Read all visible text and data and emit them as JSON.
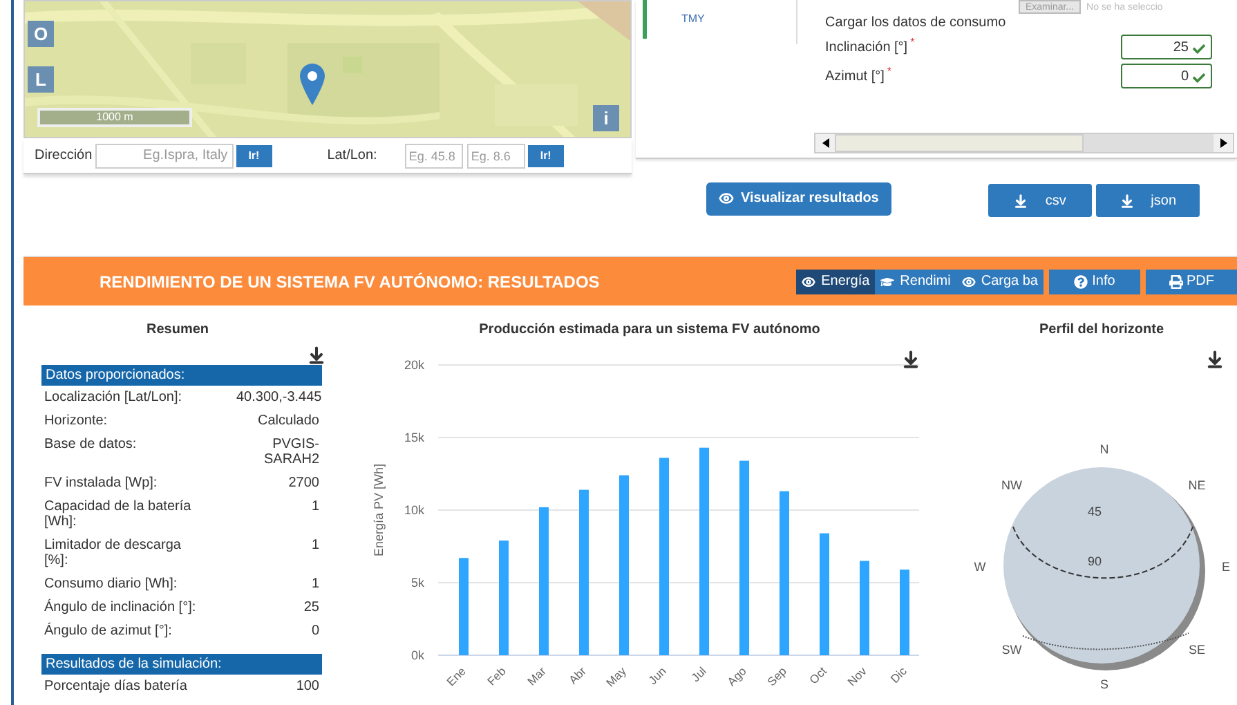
{
  "map": {
    "layer_buttons": [
      "O",
      "L"
    ],
    "info_button": "i",
    "scale": "1000 m"
  },
  "search": {
    "address_label": "Dirección",
    "address_placeholder": "Eg.Ispra, Italy",
    "address_go": "Ir!",
    "latlon_label": "Lat/Lon:",
    "lat_placeholder": "Eg. 45.8",
    "lon_placeholder": "Eg. 8.6",
    "latlon_go": "Ir!"
  },
  "side_tabs": [
    {
      "label": "TMY",
      "selected": true
    }
  ],
  "form": {
    "file_button": "Examinar...",
    "file_status": "No se ha seleccio",
    "consumption_label": "Cargar los datos de consumo",
    "fields": [
      {
        "label": "Inclinación [°]",
        "required_mark": "*",
        "value": "25",
        "valid": true
      },
      {
        "label": "Azimut [°]",
        "required_mark": "*",
        "value": "0",
        "valid": true
      }
    ]
  },
  "actions": {
    "visualize": "Visualizar resultados",
    "downloads": [
      "csv",
      "json"
    ]
  },
  "results": {
    "title": "RENDIMIENTO DE UN SISTEMA FV AUTÓNOMO: RESULTADOS",
    "tabs": [
      {
        "label": "Energía",
        "selected": true
      },
      {
        "label": "Rendimi",
        "selected": false
      },
      {
        "label": "Carga ba",
        "selected": false
      }
    ],
    "buttons": [
      {
        "kind": "info",
        "label": "Info"
      },
      {
        "kind": "pdf",
        "label": "PDF"
      }
    ]
  },
  "summary": {
    "title": "Resumen",
    "sections": [
      {
        "heading": "Datos proporcionados:",
        "rows": [
          {
            "label": "Localización [Lat/Lon]:",
            "value": "40.300,-3.445"
          },
          {
            "label": "Horizonte:",
            "value": "Calculado"
          },
          {
            "label": "Base de datos:",
            "value": "PVGIS-SARAH2"
          },
          {
            "label": "FV instalada [Wp]:",
            "value": "2700"
          },
          {
            "label": "Capacidad de la batería [Wh]:",
            "value": "1"
          },
          {
            "label": "Limitador de descarga [%]:",
            "value": "1"
          },
          {
            "label": "Consumo diario [Wh]:",
            "value": "1"
          },
          {
            "label": "Ángulo de inclinación [°]:",
            "value": "25"
          },
          {
            "label": "Ángulo de azimut [°]:",
            "value": "0"
          }
        ]
      },
      {
        "heading": "Resultados de la simulación:",
        "rows": [
          {
            "label": "Porcentaje días batería",
            "value": "100"
          }
        ]
      }
    ]
  },
  "production": {
    "title": "Producción estimada para un sistema FV autónomo",
    "chart_data": {
      "type": "bar",
      "ylabel": "Energía PV [Wh]",
      "categories": [
        "Ene",
        "Feb",
        "Mar",
        "Abr",
        "May",
        "Jun",
        "Jul",
        "Ago",
        "Sep",
        "Oct",
        "Nov",
        "Dic"
      ],
      "series": [
        {
          "color": "#2ea6ff",
          "values": [
            6700,
            7900,
            10200,
            11400,
            12400,
            13600,
            14300,
            13400,
            11300,
            8400,
            6500,
            5900
          ]
        }
      ],
      "grid": true,
      "ylim": [
        0,
        20000
      ],
      "yticks": [
        {
          "value": 0,
          "label": "0k"
        },
        {
          "value": 5000,
          "label": "5k"
        },
        {
          "value": 10000,
          "label": "10k"
        },
        {
          "value": 15000,
          "label": "15k"
        },
        {
          "value": 20000,
          "label": "20k"
        }
      ]
    }
  },
  "horizon": {
    "title": "Perfil del horizonte",
    "directions": [
      "N",
      "NE",
      "E",
      "SE",
      "S",
      "SW",
      "W",
      "NW"
    ],
    "rings": [
      "45",
      "90"
    ]
  }
}
